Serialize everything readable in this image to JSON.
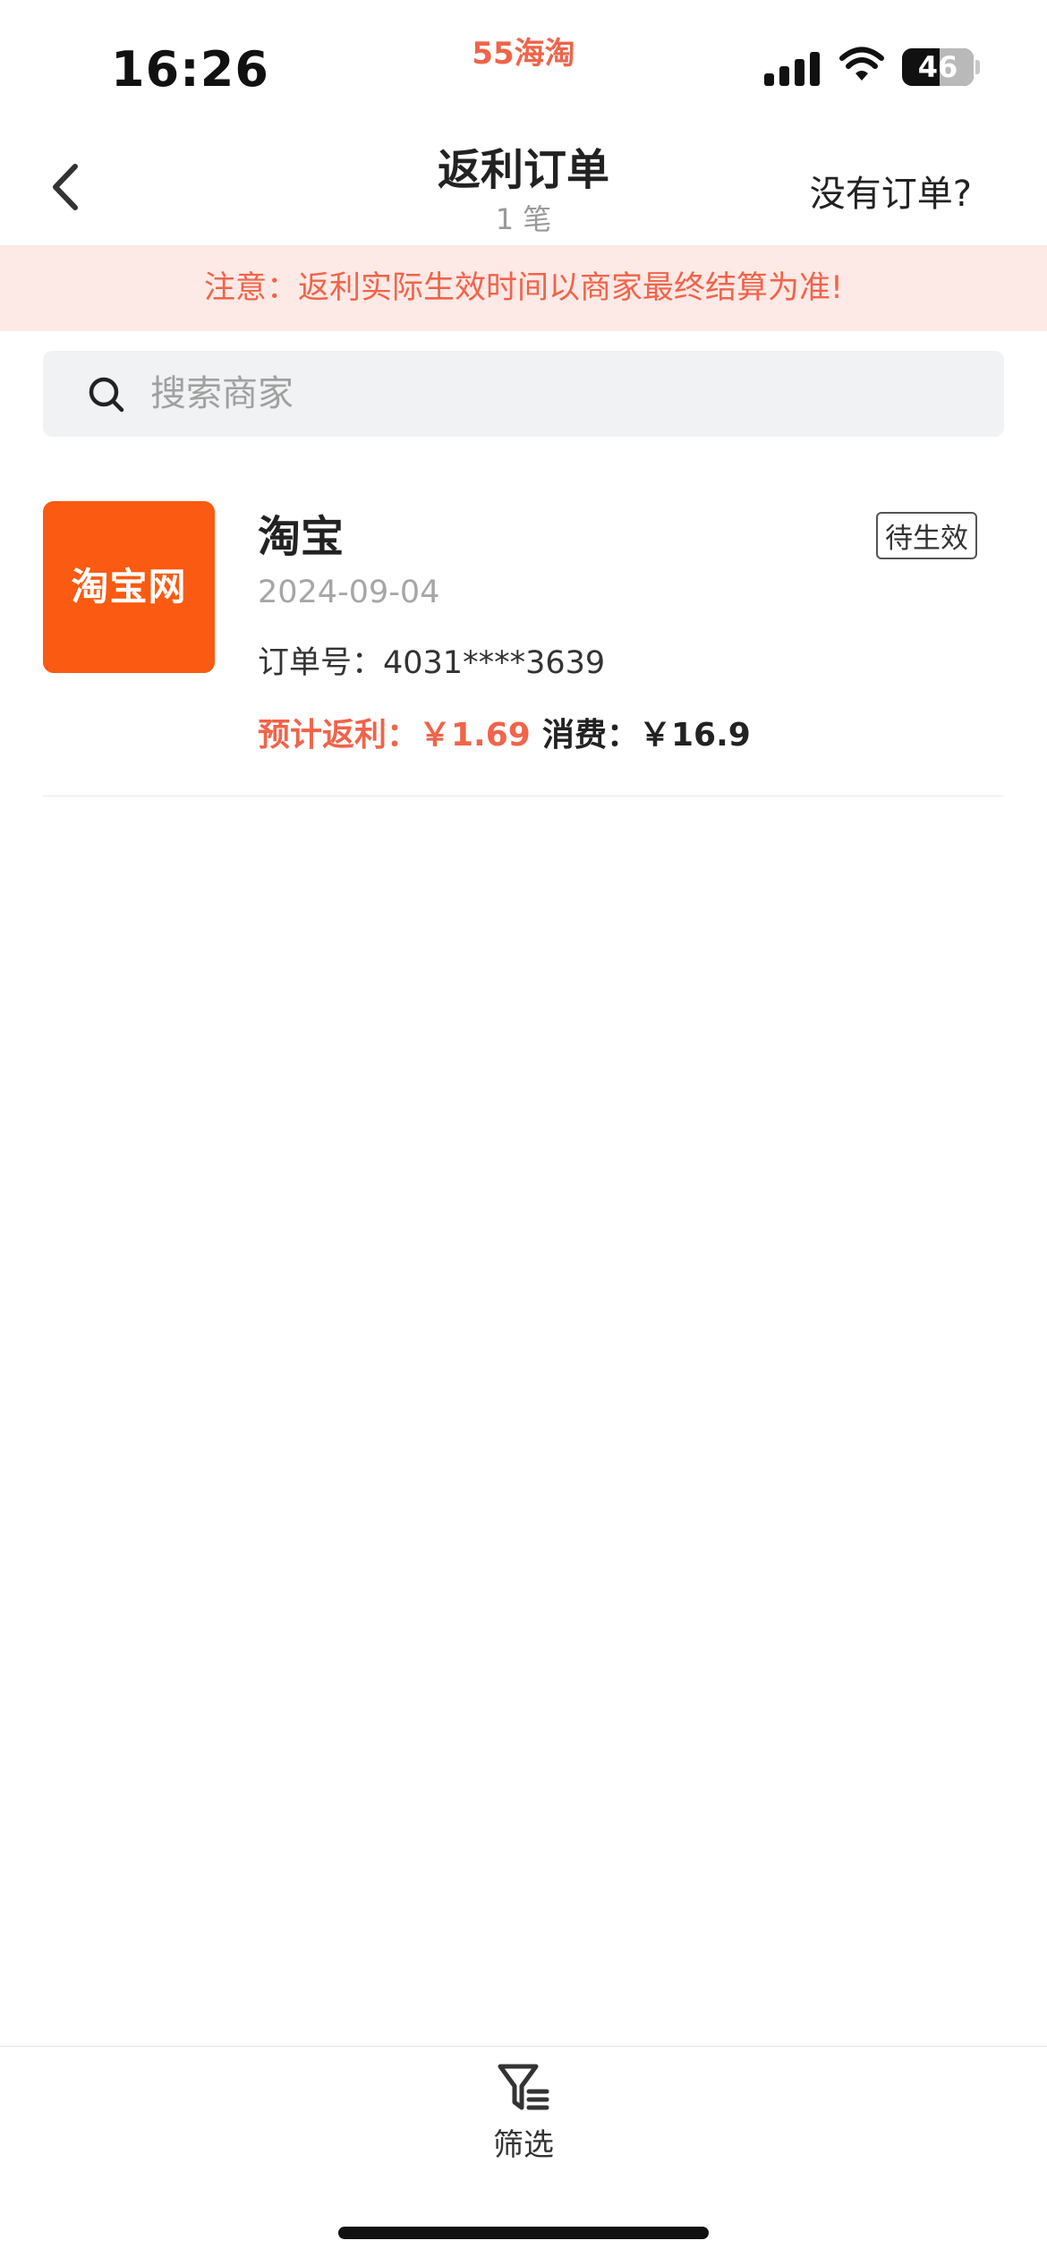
{
  "status_bar": {
    "time": "16:26",
    "app_name": "55海淘",
    "battery": "46",
    "icons": [
      "signal-icon",
      "wifi-icon",
      "battery-icon"
    ]
  },
  "header": {
    "title": "返利订单",
    "count": "1 笔",
    "no_order_link": "没有订单?",
    "back_icon": "chevron-left-icon"
  },
  "notice": {
    "text": "注意：返利实际生效时间以商家最终结算为准!"
  },
  "search": {
    "placeholder": "搜索商家",
    "value": "",
    "icon": "search-icon"
  },
  "orders": [
    {
      "merchant": "淘宝",
      "logo_text": "淘宝网",
      "date": "2024-09-04",
      "order_no": "订单号：4031****3639",
      "rebate": "预计返利：￥1.69",
      "spend": "消费：￥16.9",
      "status": "待生效"
    }
  ],
  "bottom_bar": {
    "filter_label": "筛选",
    "filter_icon": "filter-icon"
  },
  "colors": {
    "accent": "#f0644a",
    "notice_bg": "#fde9e5",
    "taobao_orange": "#fa5a11",
    "search_bg": "#f1f2f4"
  }
}
